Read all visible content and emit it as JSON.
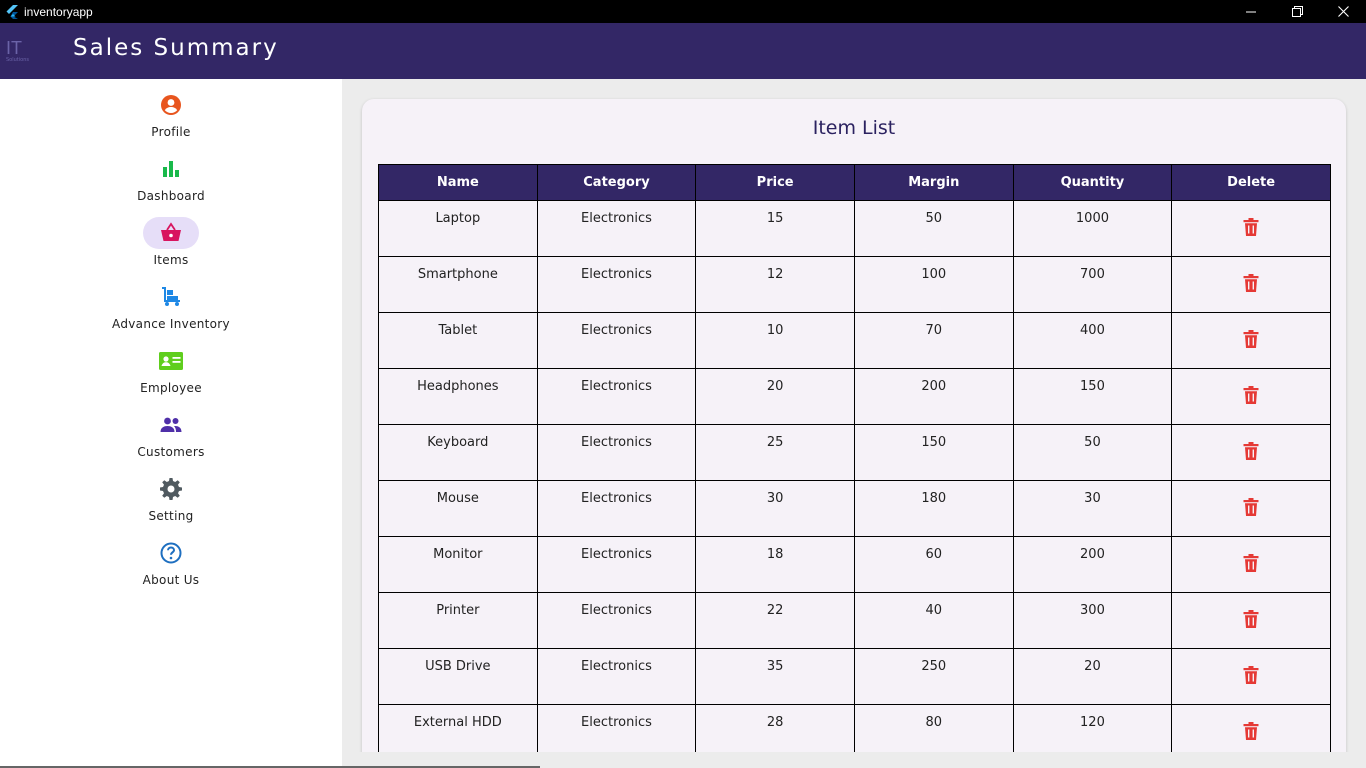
{
  "window": {
    "title": "inventoryapp",
    "icon": "flutter-logo-icon",
    "controls": [
      "minimize-icon",
      "restore-icon",
      "close-icon"
    ]
  },
  "header": {
    "logo_text": "IT",
    "logo_sub": "Solutions",
    "title": "Sales  Summary",
    "background": "#332766"
  },
  "sidebar": {
    "items": [
      {
        "label": "Profile",
        "icon": "account-circle-icon",
        "color": "#e8551e",
        "active": false
      },
      {
        "label": "Dashboard",
        "icon": "bar-chart-icon",
        "color": "#19b94b",
        "active": false
      },
      {
        "label": "Items",
        "icon": "shopping-basket-icon",
        "color": "#d8155f",
        "active": true
      },
      {
        "label": "Advance Inventory",
        "icon": "warehouse-cart-icon",
        "color": "#1e88e5",
        "active": false
      },
      {
        "label": "Employee",
        "icon": "contact-card-icon",
        "color": "#5fce1d",
        "active": false
      },
      {
        "label": "Customers",
        "icon": "people-icon",
        "color": "#4f2fa8",
        "active": false
      },
      {
        "label": "Setting",
        "icon": "gear-icon",
        "color": "#505a60",
        "active": false
      },
      {
        "label": "About Us",
        "icon": "help-circle-icon",
        "color": "#1e6fc0",
        "active": false
      }
    ]
  },
  "main": {
    "card_title": "Item List",
    "table": {
      "headers": [
        "Name",
        "Category",
        "Price",
        "Margin",
        "Quantity",
        "Delete"
      ],
      "rows": [
        {
          "name": "Laptop",
          "category": "Electronics",
          "price": "15",
          "margin": "50",
          "quantity": "1000"
        },
        {
          "name": "Smartphone",
          "category": "Electronics",
          "price": "12",
          "margin": "100",
          "quantity": "700"
        },
        {
          "name": "Tablet",
          "category": "Electronics",
          "price": "10",
          "margin": "70",
          "quantity": "400"
        },
        {
          "name": "Headphones",
          "category": "Electronics",
          "price": "20",
          "margin": "200",
          "quantity": "150"
        },
        {
          "name": "Keyboard",
          "category": "Electronics",
          "price": "25",
          "margin": "150",
          "quantity": "50"
        },
        {
          "name": "Mouse",
          "category": "Electronics",
          "price": "30",
          "margin": "180",
          "quantity": "30"
        },
        {
          "name": "Monitor",
          "category": "Electronics",
          "price": "18",
          "margin": "60",
          "quantity": "200"
        },
        {
          "name": "Printer",
          "category": "Electronics",
          "price": "22",
          "margin": "40",
          "quantity": "300"
        },
        {
          "name": "USB Drive",
          "category": "Electronics",
          "price": "35",
          "margin": "250",
          "quantity": "20"
        },
        {
          "name": "External HDD",
          "category": "Electronics",
          "price": "28",
          "margin": "80",
          "quantity": "120"
        }
      ],
      "delete_icon": "trash-icon",
      "delete_color": "#e53935"
    }
  }
}
